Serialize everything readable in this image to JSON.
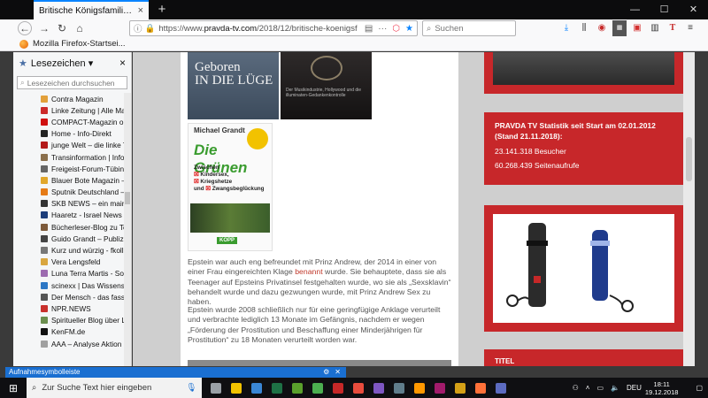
{
  "browser": {
    "tab_title": "Britische Königsfamilie erneut in e",
    "tab_close": "×",
    "new_tab": "+",
    "window_controls": [
      "—",
      "☐",
      "✕"
    ],
    "url_prefix": "https://www.",
    "url_domain": "pravda-tv.com",
    "url_path": "/2018/12/britische-koenigsf",
    "url_dots": "···",
    "search_placeholder": "Suchen",
    "bookmark_toolbar_item": "Mozilla Firefox-Startsei..."
  },
  "sidebar": {
    "title": "Lesezeichen",
    "title_chevron": "▾",
    "close": "×",
    "search_placeholder": "Lesezeichen durchsuchen",
    "items": [
      {
        "label": "Contra Magazin",
        "color": "#e2a03a"
      },
      {
        "label": "Linke Zeitung | Alle Ma...",
        "color": "#cc2a2a"
      },
      {
        "label": "COMPACT-Magazin o...",
        "color": "#d01010"
      },
      {
        "label": "Home - Info-Direkt",
        "color": "#222222"
      },
      {
        "label": "junge Welt – die linke T...",
        "color": "#b31919"
      },
      {
        "label": "Transinformation | Info...",
        "color": "#8a6f4c"
      },
      {
        "label": "Freigeist-Forum-Tübin...",
        "color": "#666666"
      },
      {
        "label": "Blauer Bote Magazin – ...",
        "color": "#e1a72b"
      },
      {
        "label": "Sputnik Deutschland – ...",
        "color": "#e57b17"
      },
      {
        "label": "SKB NEWS – ein mainst...",
        "color": "#333333"
      },
      {
        "label": "Haaretz - Israel News | ...",
        "color": "#1c3d7a"
      },
      {
        "label": "Bücherleser-Blog zu Te...",
        "color": "#7d5a3a"
      },
      {
        "label": "Guido Grandt – Publizis...",
        "color": "#444444"
      },
      {
        "label": "Kurz und würzig - fkoll...",
        "color": "#777777"
      },
      {
        "label": "Vera Lengsfeld",
        "color": "#d9a640"
      },
      {
        "label": "Luna Terra Martis - Sou...",
        "color": "#9d6bb0"
      },
      {
        "label": "scinexx | Das Wissensm...",
        "color": "#2c77c5"
      },
      {
        "label": "Der Mensch - das fassi...",
        "color": "#555555"
      },
      {
        "label": "NPR.NEWS",
        "color": "#c9302c"
      },
      {
        "label": "Spiritueller Blog über L...",
        "color": "#6b8e4e"
      },
      {
        "label": "KenFM.de",
        "color": "#111111"
      },
      {
        "label": "AAA – Analyse Aktion ...",
        "color": "#a0a0a0"
      }
    ]
  },
  "content": {
    "book1_title": "Geboren\nIN DIE LÜGE",
    "book2_text": "Der Musikindustrie, Hollywood und die illuminaten-Gedankenkontrolle",
    "book3_author": "Michael Grandt",
    "book3_title": "Die Grünen",
    "book3_lines": [
      "Zwischen",
      "Kindersex,",
      "Kriegshetze",
      "und",
      "Zwangsbeglückung"
    ],
    "book3_publisher": "KOPP",
    "para1_before": "Epstein war auch eng befreundet mit Prinz Andrew, der 2014 in einer von einer Frau eingereichten Klage ",
    "para1_link": "benannt",
    "para1_after": " wurde. Sie behauptete, dass sie als Teenager auf Epsteins Privatinsel festgehalten wurde, wo sie als „Sexsklavin“ behandelt wurde und dazu gezwungen wurde, mit Prinz Andrew Sex zu haben.",
    "para2": "Epstein wurde 2008 schließlich nur für eine geringfügige Anklage verurteilt und verbrachte lediglich 13 Monate im Gefängnis, nachdem er wegen „Förderung der Prostitution und Beschaffung einer Minderjährigen für Prostitution“ zu 18 Monaten verurteilt worden war."
  },
  "widgets": {
    "stats_heading": "PRAVDA TV Statistik seit Start am 02.01.2012 (Stand 21.11.2018):",
    "visitors": "23.141.318 Besucher",
    "pageviews": "60.268.439 Seitenaufrufe",
    "bottom_label": "TITEL"
  },
  "taskbar": {
    "notification": "Aufnahmesymbolleiste",
    "search_placeholder": "Zur Suche Text hier eingeben",
    "language": "DEU",
    "time": "18:11",
    "date": "19.12.2018",
    "icons": [
      {
        "name": "task-view",
        "color": "#9aa0a6"
      },
      {
        "name": "camera",
        "color": "#f2c200"
      },
      {
        "name": "monitor",
        "color": "#3a86d4"
      },
      {
        "name": "excel",
        "color": "#1e7145"
      },
      {
        "name": "app-green",
        "color": "#5aa02c"
      },
      {
        "name": "chrome",
        "color": "#4caf50"
      },
      {
        "name": "video-editor",
        "color": "#c62828"
      },
      {
        "name": "media-player",
        "color": "#e84c3d"
      },
      {
        "name": "app-purple",
        "color": "#7e57c2"
      },
      {
        "name": "app-grey",
        "color": "#607d8b"
      },
      {
        "name": "app-orange",
        "color": "#ff9800"
      },
      {
        "name": "app-magenta",
        "color": "#a21b6b"
      },
      {
        "name": "app-gold",
        "color": "#d4a017"
      },
      {
        "name": "firefox",
        "color": "#ff7139"
      },
      {
        "name": "calculator",
        "color": "#5c6bc0"
      }
    ]
  }
}
